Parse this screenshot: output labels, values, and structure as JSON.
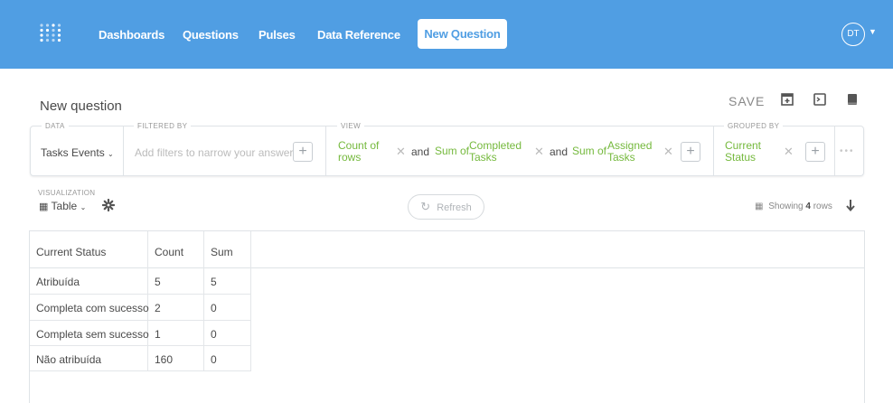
{
  "nav": {
    "links": [
      "Dashboards",
      "Questions",
      "Pulses",
      "Data Reference"
    ],
    "new_question": "New Question",
    "avatar_initials": "DT",
    "brand_color": "#509ee3"
  },
  "header": {
    "title": "New question",
    "save": "SAVE"
  },
  "query": {
    "data_label": "DATA",
    "data_value": "Tasks Events",
    "filter_label": "FILTERED BY",
    "filter_placeholder": "Add filters to narrow your answer",
    "view_label": "VIEW",
    "and1": "and",
    "and2": "and",
    "agg1": [
      "Count of",
      "rows"
    ],
    "agg2_prefix": "Sum of",
    "agg2_field": [
      "Completed",
      "Tasks"
    ],
    "agg3_prefix": "Sum of",
    "agg3_field": [
      "Assigned",
      "Tasks"
    ],
    "group_label": "GROUPED BY",
    "group_value": [
      "Current",
      "Status"
    ],
    "accent_color": "#75b93d"
  },
  "toolbar": {
    "viz_label": "VISUALIZATION",
    "viz_type": "Table",
    "refresh": "Refresh",
    "showing_prefix": "Showing",
    "row_count": "4",
    "showing_suffix": "rows"
  },
  "table": {
    "columns": [
      "Current Status",
      "Count",
      "Sum"
    ],
    "rows": [
      [
        "Atribuída",
        "5",
        "5"
      ],
      [
        "Completa com sucesso",
        "2",
        "0"
      ],
      [
        "Completa sem sucesso",
        "1",
        "0"
      ],
      [
        "Não atribuída",
        "160",
        "0"
      ]
    ]
  }
}
